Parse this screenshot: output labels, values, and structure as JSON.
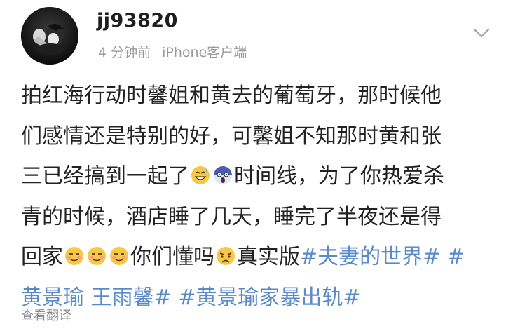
{
  "post": {
    "username": "jj93820",
    "time_ago": "4 分钟前",
    "source": "iPhone客户端",
    "content": {
      "line1": "拍红海行动时馨姐和黄去的葡萄牙，那时候他",
      "line2": "们感情还是特别的好，可馨姐不知那时黄和张",
      "line3_a": "三已经搞到一起了",
      "line3_b": "时间线，为了你热爱杀",
      "line4": "青的时候，酒店睡了几天，睡完了半夜还是得",
      "line5_a": "回家",
      "line5_b": "你们懂吗",
      "line5_c": "真实版",
      "hashtag1": "#夫妻的世界#",
      "hashtag2_part1": "#",
      "hashtag2_part2": "黄景瑜 王雨馨#",
      "hashtag3": "#黄景瑜家暴出轨#"
    },
    "emojis": [
      "grin-sweat-icon",
      "shocked-scream-icon",
      "awkward-smile-icon",
      "awkward-smile-icon",
      "awkward-smile-icon",
      "sad-face-icon"
    ],
    "translate_label": "查看翻译"
  },
  "colors": {
    "hashtag": "#5b8ac8",
    "meta": "#9a9a9a",
    "text": "#222222"
  }
}
